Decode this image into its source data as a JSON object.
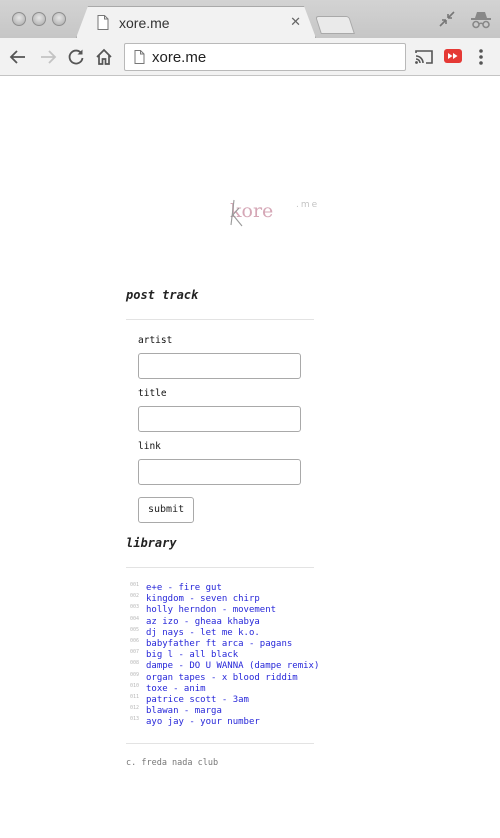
{
  "browser": {
    "tab_title": "xore.me",
    "tab_close": "✕",
    "url": "xore.me"
  },
  "icons": {
    "page": "document-icon",
    "fullscreen": "fullscreen-exit-icon",
    "incognito": "incognito-icon",
    "back": "arrow-back-icon",
    "forward": "arrow-forward-icon",
    "reload": "reload-icon",
    "home": "home-icon",
    "cast": "cast-icon",
    "extension": "extension-icon",
    "menu": "kebab-menu-icon"
  },
  "colors": {
    "link": "#2727d9",
    "logo_pink": "#d5a7b6",
    "logo_gray": "#9a9a9a",
    "extension_red": "#e53935"
  },
  "logo": {
    "main": "kore",
    "suffix": ".me"
  },
  "post": {
    "title": "post track",
    "artist_label": "artist",
    "title_label": "title",
    "link_label": "link",
    "submit_label": "submit"
  },
  "library": {
    "title": "library",
    "tracks": [
      {
        "num": "001",
        "text": "e+e - fire gut"
      },
      {
        "num": "002",
        "text": "kingdom - seven chirp"
      },
      {
        "num": "003",
        "text": "holly herndon - movement"
      },
      {
        "num": "004",
        "text": "az izo - gheaa khabya"
      },
      {
        "num": "005",
        "text": "dj nays - let me k.o."
      },
      {
        "num": "006",
        "text": "babyfather ft arca - pagans"
      },
      {
        "num": "007",
        "text": "big l - all black"
      },
      {
        "num": "008",
        "text": "dampe - DO U WANNA (dampe remix)"
      },
      {
        "num": "009",
        "text": "organ tapes - x blood riddim"
      },
      {
        "num": "010",
        "text": "toxe - anim"
      },
      {
        "num": "011",
        "text": "patrice scott - 3am"
      },
      {
        "num": "012",
        "text": "blawan - marga"
      },
      {
        "num": "013",
        "text": "ayo jay - your number"
      }
    ]
  },
  "footer": {
    "text": "c. freda nada club"
  }
}
